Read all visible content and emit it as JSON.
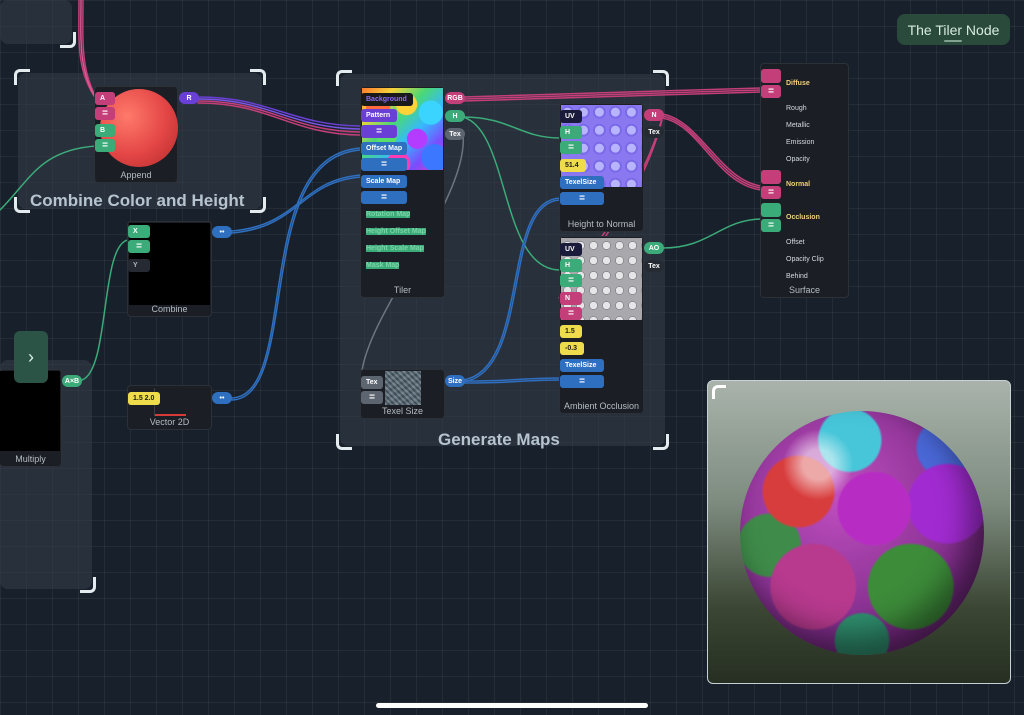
{
  "header": {
    "title": "The Tiler Node"
  },
  "groups": {
    "combine": {
      "title": "Combine Color and Height"
    },
    "generate": {
      "title": "Generate Maps"
    }
  },
  "nodes": {
    "append": {
      "title": "Append",
      "inputs": [
        "A",
        "=",
        "B",
        "="
      ],
      "output": "R"
    },
    "combine": {
      "title": "Combine",
      "inputs": [
        "X",
        "=",
        "Y"
      ],
      "output": "••"
    },
    "vector2d": {
      "title": "Vector 2D",
      "value": "1.5 2.0",
      "output": "••"
    },
    "multiply": {
      "title": "Multiply",
      "output": "A×B"
    },
    "tiler": {
      "title": "Tiler",
      "inputs": [
        "Background",
        "Pattern",
        "=",
        "Offset Map",
        "=",
        "Scale Map",
        "="
      ],
      "extra_inputs": [
        "Rotation Map",
        "Height Offset Map",
        "Height Scale Map",
        "Mask Map"
      ],
      "outputs": [
        "RGB",
        "H",
        "Tex"
      ]
    },
    "texel_size": {
      "title": "Texel Size",
      "inputs": [
        "Tex",
        "="
      ],
      "output": "Size"
    },
    "height_to_normal": {
      "title": "Height to Normal",
      "inputs": [
        "UV",
        "H",
        "=",
        "51.4",
        "TexelSize",
        "="
      ],
      "outputs": [
        "N",
        "Tex"
      ]
    },
    "ambient_occlusion": {
      "title": "Ambient Occlusion",
      "inputs": [
        "UV",
        "H",
        "=",
        "N",
        "=",
        "1.5",
        "-0.3",
        "TexelSize",
        "="
      ],
      "outputs": [
        "AO",
        "Tex"
      ]
    },
    "surface": {
      "title": "Surface",
      "inputs": [
        "Diffuse",
        "=",
        "Rough",
        "Metallic",
        "Emission",
        "Opacity",
        "Normal",
        "=",
        "Occlusion",
        "=",
        "Offset",
        "Opacity Clip",
        "Behind"
      ]
    }
  },
  "side_button": {
    "icon": "chevron-right-icon",
    "glyph": "›"
  },
  "preview": {
    "subject": "sphere-preview"
  },
  "colors": {
    "pink": "#c43f79",
    "blue": "#2f6fc0",
    "green": "#3bab79",
    "purple": "#6a3fd6",
    "yellow": "#efdc4d",
    "canvas": "#18212b"
  }
}
